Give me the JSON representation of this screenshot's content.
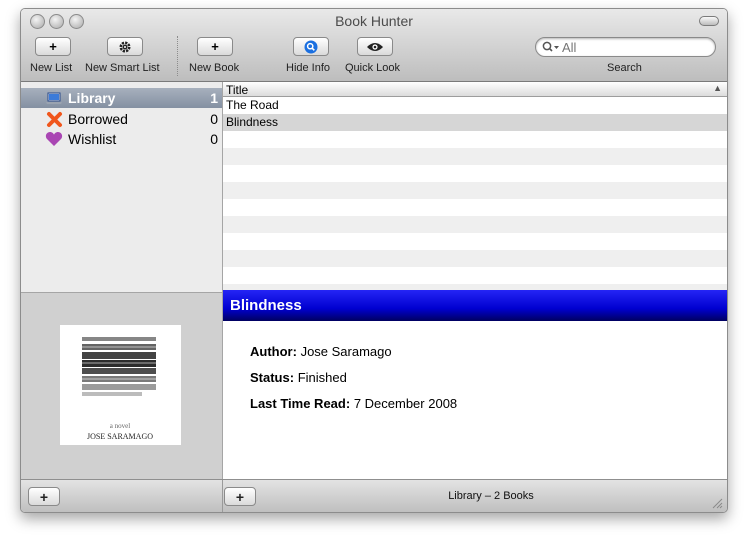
{
  "window": {
    "title": "Book Hunter"
  },
  "toolbar": {
    "new_list": "New List",
    "new_smart_list": "New Smart List",
    "new_book": "New Book",
    "hide_info": "Hide Info",
    "quick_look": "Quick Look",
    "search_label": "Search",
    "search_placeholder": "All"
  },
  "sidebar": {
    "items": [
      {
        "label": "Library",
        "count": "1",
        "icon": "laptop-icon",
        "selected": true
      },
      {
        "label": "Borrowed",
        "count": "0",
        "icon": "x-mark-icon",
        "selected": false
      },
      {
        "label": "Wishlist",
        "count": "0",
        "icon": "heart-icon",
        "selected": false
      }
    ]
  },
  "table": {
    "column": "Title",
    "rows": [
      "The Road",
      "Blindness"
    ]
  },
  "info": {
    "title": "Blindness",
    "author_label": "Author:",
    "author": "Jose Saramago",
    "status_label": "Status:",
    "status": "Finished",
    "last_read_label": "Last Time Read:",
    "last_read": "7 December 2008",
    "cover_author": "JOSE SARAMAGO",
    "cover_title": "BLINDNESS"
  },
  "bottom": {
    "status": "Library – 2 Books",
    "add_list_label": "+",
    "add_book_label": "+"
  },
  "colors": {
    "info_header": "#0000d0",
    "selection": "#8b96a8"
  }
}
